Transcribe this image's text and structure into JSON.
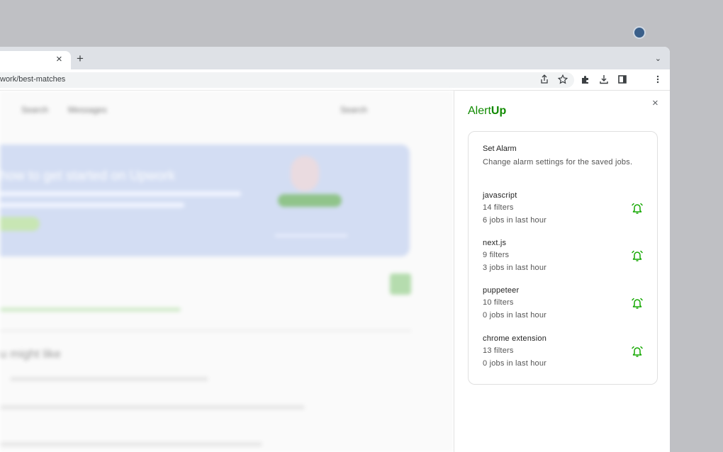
{
  "browser": {
    "tab_close_glyph": "×",
    "new_tab_glyph": "+",
    "tabstrip_menu_glyph": "⌄",
    "url": "work/best-matches",
    "toolbar_icons": [
      "share-icon",
      "star-icon",
      "extensions-icon",
      "download-icon",
      "side-panel-icon",
      "profile-avatar",
      "more-menu-icon"
    ]
  },
  "panel": {
    "close_glyph": "×",
    "brand_prefix": "Alert",
    "brand_suffix": "Up",
    "accent_color": "#108a00",
    "bell_color": "#14a800",
    "card": {
      "title": "Set Alarm",
      "description": "Change alarm settings for the saved jobs.",
      "alarms": [
        {
          "name": "javascript",
          "filters": "14 filters",
          "jobs": "6 jobs in last hour"
        },
        {
          "name": "next.js",
          "filters": "9 filters",
          "jobs": "3 jobs in last hour"
        },
        {
          "name": "puppeteer",
          "filters": "10 filters",
          "jobs": "0 jobs in last hour"
        },
        {
          "name": "chrome extension",
          "filters": "13 filters",
          "jobs": "0 jobs in last hour"
        }
      ]
    }
  },
  "background_page": {
    "banner_title": "how to get started on Upwork"
  }
}
